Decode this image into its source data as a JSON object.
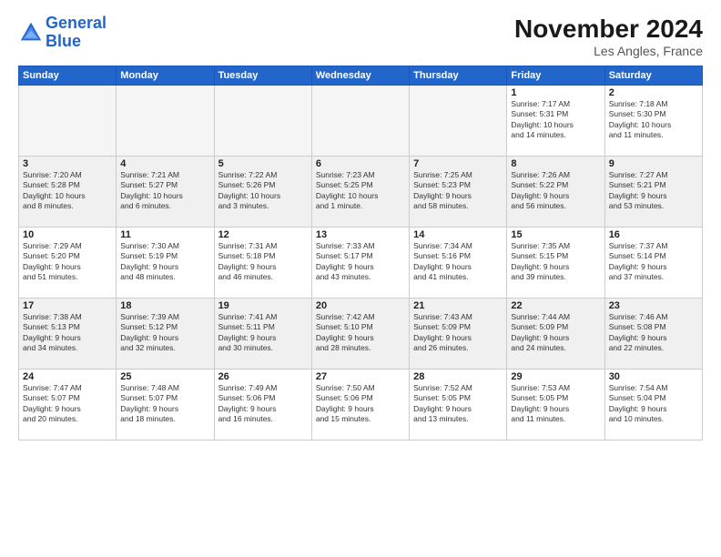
{
  "logo": {
    "line1": "General",
    "line2": "Blue"
  },
  "title": "November 2024",
  "location": "Les Angles, France",
  "days_of_week": [
    "Sunday",
    "Monday",
    "Tuesday",
    "Wednesday",
    "Thursday",
    "Friday",
    "Saturday"
  ],
  "weeks": [
    [
      {
        "day": "",
        "info": "",
        "empty": true
      },
      {
        "day": "",
        "info": "",
        "empty": true
      },
      {
        "day": "",
        "info": "",
        "empty": true
      },
      {
        "day": "",
        "info": "",
        "empty": true
      },
      {
        "day": "",
        "info": "",
        "empty": true
      },
      {
        "day": "1",
        "info": "Sunrise: 7:17 AM\nSunset: 5:31 PM\nDaylight: 10 hours\nand 14 minutes."
      },
      {
        "day": "2",
        "info": "Sunrise: 7:18 AM\nSunset: 5:30 PM\nDaylight: 10 hours\nand 11 minutes."
      }
    ],
    [
      {
        "day": "3",
        "info": "Sunrise: 7:20 AM\nSunset: 5:28 PM\nDaylight: 10 hours\nand 8 minutes."
      },
      {
        "day": "4",
        "info": "Sunrise: 7:21 AM\nSunset: 5:27 PM\nDaylight: 10 hours\nand 6 minutes."
      },
      {
        "day": "5",
        "info": "Sunrise: 7:22 AM\nSunset: 5:26 PM\nDaylight: 10 hours\nand 3 minutes."
      },
      {
        "day": "6",
        "info": "Sunrise: 7:23 AM\nSunset: 5:25 PM\nDaylight: 10 hours\nand 1 minute."
      },
      {
        "day": "7",
        "info": "Sunrise: 7:25 AM\nSunset: 5:23 PM\nDaylight: 9 hours\nand 58 minutes."
      },
      {
        "day": "8",
        "info": "Sunrise: 7:26 AM\nSunset: 5:22 PM\nDaylight: 9 hours\nand 56 minutes."
      },
      {
        "day": "9",
        "info": "Sunrise: 7:27 AM\nSunset: 5:21 PM\nDaylight: 9 hours\nand 53 minutes."
      }
    ],
    [
      {
        "day": "10",
        "info": "Sunrise: 7:29 AM\nSunset: 5:20 PM\nDaylight: 9 hours\nand 51 minutes."
      },
      {
        "day": "11",
        "info": "Sunrise: 7:30 AM\nSunset: 5:19 PM\nDaylight: 9 hours\nand 48 minutes."
      },
      {
        "day": "12",
        "info": "Sunrise: 7:31 AM\nSunset: 5:18 PM\nDaylight: 9 hours\nand 46 minutes."
      },
      {
        "day": "13",
        "info": "Sunrise: 7:33 AM\nSunset: 5:17 PM\nDaylight: 9 hours\nand 43 minutes."
      },
      {
        "day": "14",
        "info": "Sunrise: 7:34 AM\nSunset: 5:16 PM\nDaylight: 9 hours\nand 41 minutes."
      },
      {
        "day": "15",
        "info": "Sunrise: 7:35 AM\nSunset: 5:15 PM\nDaylight: 9 hours\nand 39 minutes."
      },
      {
        "day": "16",
        "info": "Sunrise: 7:37 AM\nSunset: 5:14 PM\nDaylight: 9 hours\nand 37 minutes."
      }
    ],
    [
      {
        "day": "17",
        "info": "Sunrise: 7:38 AM\nSunset: 5:13 PM\nDaylight: 9 hours\nand 34 minutes."
      },
      {
        "day": "18",
        "info": "Sunrise: 7:39 AM\nSunset: 5:12 PM\nDaylight: 9 hours\nand 32 minutes."
      },
      {
        "day": "19",
        "info": "Sunrise: 7:41 AM\nSunset: 5:11 PM\nDaylight: 9 hours\nand 30 minutes."
      },
      {
        "day": "20",
        "info": "Sunrise: 7:42 AM\nSunset: 5:10 PM\nDaylight: 9 hours\nand 28 minutes."
      },
      {
        "day": "21",
        "info": "Sunrise: 7:43 AM\nSunset: 5:09 PM\nDaylight: 9 hours\nand 26 minutes."
      },
      {
        "day": "22",
        "info": "Sunrise: 7:44 AM\nSunset: 5:09 PM\nDaylight: 9 hours\nand 24 minutes."
      },
      {
        "day": "23",
        "info": "Sunrise: 7:46 AM\nSunset: 5:08 PM\nDaylight: 9 hours\nand 22 minutes."
      }
    ],
    [
      {
        "day": "24",
        "info": "Sunrise: 7:47 AM\nSunset: 5:07 PM\nDaylight: 9 hours\nand 20 minutes."
      },
      {
        "day": "25",
        "info": "Sunrise: 7:48 AM\nSunset: 5:07 PM\nDaylight: 9 hours\nand 18 minutes."
      },
      {
        "day": "26",
        "info": "Sunrise: 7:49 AM\nSunset: 5:06 PM\nDaylight: 9 hours\nand 16 minutes."
      },
      {
        "day": "27",
        "info": "Sunrise: 7:50 AM\nSunset: 5:06 PM\nDaylight: 9 hours\nand 15 minutes."
      },
      {
        "day": "28",
        "info": "Sunrise: 7:52 AM\nSunset: 5:05 PM\nDaylight: 9 hours\nand 13 minutes."
      },
      {
        "day": "29",
        "info": "Sunrise: 7:53 AM\nSunset: 5:05 PM\nDaylight: 9 hours\nand 11 minutes."
      },
      {
        "day": "30",
        "info": "Sunrise: 7:54 AM\nSunset: 5:04 PM\nDaylight: 9 hours\nand 10 minutes."
      }
    ]
  ]
}
